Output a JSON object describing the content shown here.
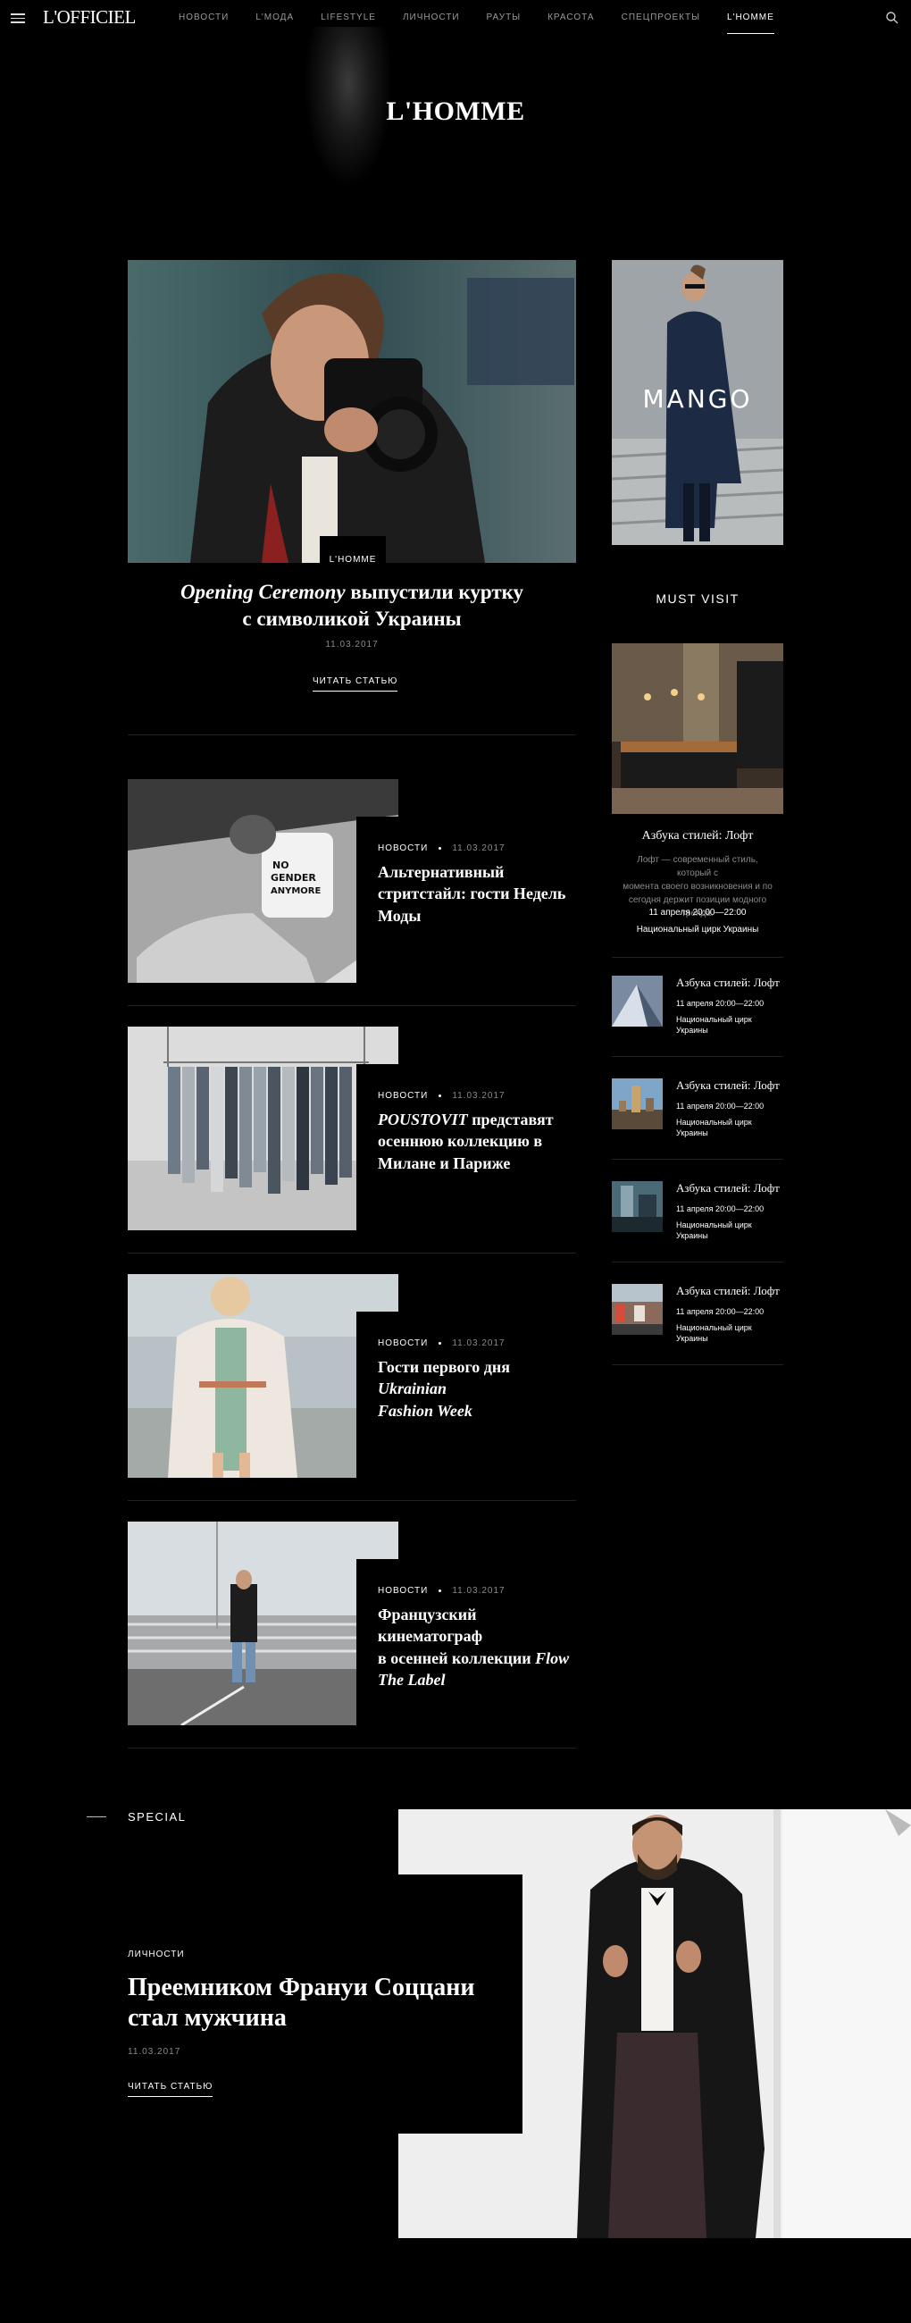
{
  "header": {
    "logo": "L'OFFICIEL",
    "nav": [
      "НОВОСТИ",
      "L'МОДА",
      "LIFESTYLE",
      "ЛИЧНОСТИ",
      "РАУТЫ",
      "КРАСОТА",
      "СПЕЦПРОЕКТЫ",
      "L'HOMME"
    ],
    "active_nav": "L'HOMME"
  },
  "page": {
    "title": "L'HOMME"
  },
  "featured": {
    "badge": "L'HOMME",
    "title_italic": "Opening Ceremony",
    "title_line1_rest": " выпустили куртку",
    "title_line2": "с символикой Украины",
    "date": "11.03.2017",
    "read_more": "ЧИТАТЬ СТАТЬЮ"
  },
  "articles": [
    {
      "category": "НОВОСТИ",
      "date": "11.03.2017",
      "title_l1": "Альтернативный",
      "title_l2": "стритстайл: гости Недель",
      "title_l3": "Моды"
    },
    {
      "category": "НОВОСТИ",
      "date": "11.03.2017",
      "title_l1_i": "POUSTOVIT",
      "title_l1": " представят",
      "title_l2": "осеннюю коллекцию в",
      "title_l3": "Милане и Париже"
    },
    {
      "category": "НОВОСТИ",
      "date": "11.03.2017",
      "title_l1": "Гости первого дня ",
      "title_l1_i": "Ukrainian",
      "title_l2_i": "Fashion Week"
    },
    {
      "category": "НОВОСТИ",
      "date": "11.03.2017",
      "title_l1": "Французский кинематограф",
      "title_l2": "в осенней коллекции ",
      "title_l2_i": "Flow",
      "title_l3_i": "The Label"
    }
  ],
  "sidebar": {
    "ad_brand": "MANGO",
    "must_visit": "MUST VISIT",
    "main_event": {
      "title": "Азбука стилей: Лофт",
      "desc_l1": "Лофт — современный стиль, который с",
      "desc_l2": "момента своего возникновения и по",
      "desc_l3": "сегодня держит позиции модного тренда.",
      "time": "11 апреля 20:00—22:00",
      "place": "Национальный цирк Украины"
    },
    "events": [
      {
        "title": "Азбука стилей: Лофт",
        "time": "11 апреля 20:00—22:00",
        "place_l1": "Национальный цирк",
        "place_l2": "Украины"
      },
      {
        "title": "Азбука стилей: Лофт",
        "time": "11 апреля 20:00—22:00",
        "place_l1": "Национальный цирк",
        "place_l2": "Украины"
      },
      {
        "title": "Азбука стилей: Лофт",
        "time": "11 апреля 20:00—22:00",
        "place_l1": "Национальный цирк",
        "place_l2": "Украины"
      },
      {
        "title": "Азбука стилей: Лофт",
        "time": "11 апреля 20:00—22:00",
        "place_l1": "Национальный цирк",
        "place_l2": "Украины"
      }
    ]
  },
  "special": {
    "label": "SPECIAL",
    "category": "ЛИЧНОСТИ",
    "title_l1": "Преемником Франуи Соццани",
    "title_l2": "стал мужчина",
    "date": "11.03.2017",
    "read_more": "ЧИТАТЬ СТАТЬЮ"
  }
}
